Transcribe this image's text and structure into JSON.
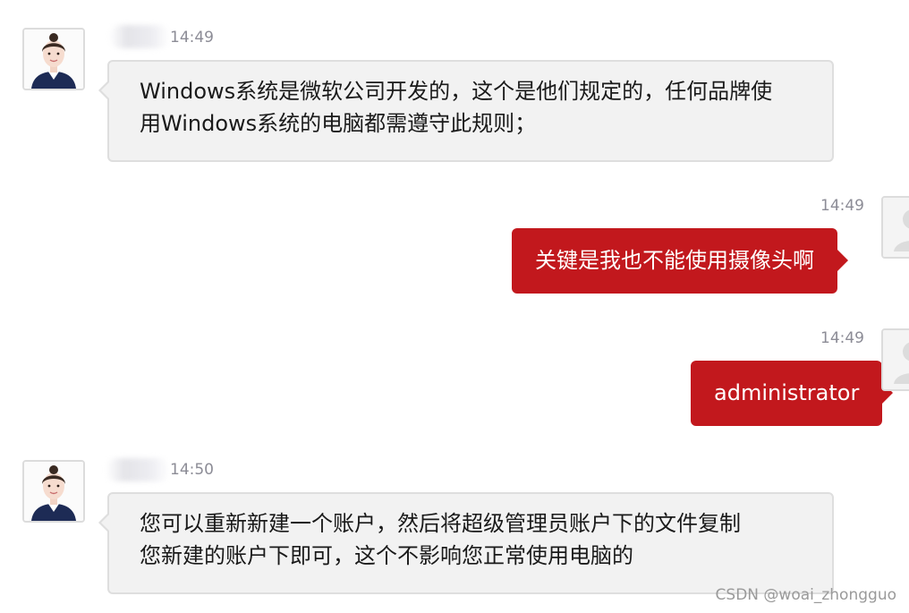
{
  "colors": {
    "agent_bubble": "#f2f2f2",
    "user_bubble": "#c2181d",
    "timestamp": "#8c8c96"
  },
  "messages": [
    {
      "sender": "agent",
      "time": "14:49",
      "lines": [
        "Windows系统是微软公司开发的，这个是他们规定的，任何品牌使",
        "用Windows系统的电脑都需遵守此规则；"
      ]
    },
    {
      "sender": "user",
      "time": "14:49",
      "text": "关键是我也不能使用摄像头啊"
    },
    {
      "sender": "user",
      "time": "14:49",
      "text": "administrator"
    },
    {
      "sender": "agent",
      "time": "14:50",
      "lines": [
        "您可以重新新建一个账户，然后将超级管理员账户下的文件复制",
        "您新建的账户下即可，这个不影响您正常使用电脑的"
      ]
    }
  ],
  "watermark": "CSDN @woai_zhongguo"
}
